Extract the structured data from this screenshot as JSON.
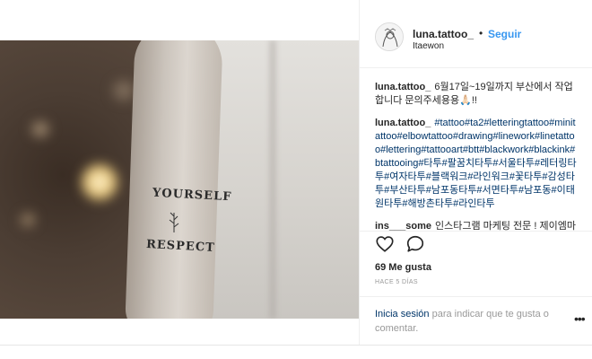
{
  "post": {
    "photo": {
      "alt": "Forearm tattoo reading YOURSELF RESPECT",
      "tattoo_line1": "YOURSELF",
      "tattoo_line2": "RESPECT"
    },
    "header": {
      "username": "luna.tattoo_",
      "separator": "•",
      "follow_label": "Seguir",
      "location": "Itaewon",
      "avatar_icon": "avatar-illustration-icon"
    },
    "comments": [
      {
        "user": "luna.tattoo_",
        "text": "6월17일~19일까지 부산에서 작업합니다 문의주세용용🙏🏻!!"
      },
      {
        "user": "luna.tattoo_",
        "text": "#tattoo#ta2#letteringtattoo#minitattoo#elbowtattoo#drawing#linework#linetattoo#lettering#tattooart#btt#blackwork#blackink#btattooing#타투#팔꿈치타투#서울타투#레터링타투#여자타투#블랙워크#라인워크#꽃타투#감성타투#부산타투#남포동타투#서면타투#남포동#이태원타투#해방촌타투#라인타투"
      },
      {
        "user": "ins___some",
        "text": "인스타그램 마케팅 전문 ! 제이엠마케팅 입니다. 인스타그램을 통해 광고를 하자"
      }
    ],
    "actions": {
      "like_icon": "heart-icon",
      "comment_icon": "comment-bubble-icon"
    },
    "likes": "69 Me gusta",
    "time_ago": "HACE 5 DÍAS",
    "login_prompt": {
      "link": "Inicia sesión",
      "text": " para indicar que te gusta o comentar."
    },
    "more_icon": "more-options-icon",
    "more_label": "•••",
    "colors": {
      "link_blue": "#3897f0",
      "hashtag_blue": "#003569",
      "text": "#262626",
      "muted": "#999999"
    }
  }
}
